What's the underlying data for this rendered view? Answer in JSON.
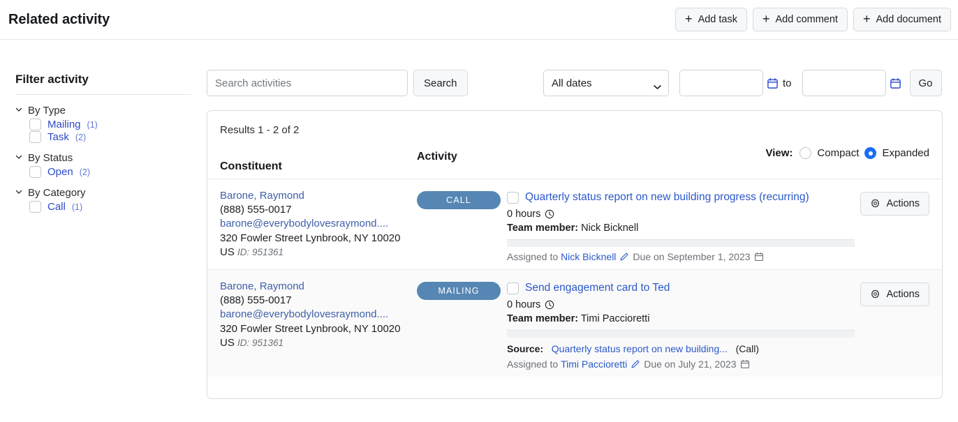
{
  "header": {
    "title": "Related activity",
    "buttons": [
      {
        "label": "Add task",
        "icon": "plus-icon"
      },
      {
        "label": "Add comment",
        "icon": "plus-icon"
      },
      {
        "label": "Add document",
        "icon": "plus-icon"
      }
    ]
  },
  "sidebar": {
    "title": "Filter activity",
    "groups": [
      {
        "label": "By Type",
        "expanded": true,
        "items": [
          {
            "label": "Mailing",
            "count": "(1)",
            "checked": false
          },
          {
            "label": "Task",
            "count": "(2)",
            "checked": false
          }
        ]
      },
      {
        "label": "By Status",
        "expanded": true,
        "items": [
          {
            "label": "Open",
            "count": "(2)",
            "checked": false
          }
        ]
      },
      {
        "label": "By Category",
        "expanded": true,
        "items": [
          {
            "label": "Call",
            "count": "(1)",
            "checked": false
          }
        ]
      }
    ]
  },
  "toolbar": {
    "search_placeholder": "Search activities",
    "search_value": "",
    "search_button": "Search",
    "date_filter_selected": "All dates",
    "date_from_value": "",
    "date_to_value": "",
    "to_label": "to",
    "go_button": "Go"
  },
  "results": {
    "count_text": "Results 1 - 2 of 2",
    "columns": {
      "constituent": "Constituent",
      "activity": "Activity"
    },
    "view": {
      "label": "View:",
      "options": [
        "Compact",
        "Expanded"
      ],
      "selected": "Expanded"
    },
    "actions_button": "Actions",
    "rows": [
      {
        "constituent": {
          "name": "Barone, Raymond",
          "phone": "(888) 555-0017",
          "email": "barone@everybodylovesraymond....",
          "address1": "320 Fowler Street",
          "address2": "Lynbrook, NY 10020",
          "country": "US",
          "id": "ID: 951361"
        },
        "badge": "CALL",
        "title": "Quarterly status report on new building progress (recurring)",
        "hours": "0 hours",
        "team_member_label": "Team member:",
        "team_member": "Nick Bicknell",
        "source_label": "",
        "source_link": "",
        "source_type": "",
        "assigned_prefix": "Assigned to",
        "assigned_to": "Nick Bicknell",
        "due_text": "Due on September 1, 2023",
        "checked": false
      },
      {
        "constituent": {
          "name": "Barone, Raymond",
          "phone": "(888) 555-0017",
          "email": "barone@everybodylovesraymond....",
          "address1": "320 Fowler Street",
          "address2": "Lynbrook, NY 10020",
          "country": "US",
          "id": "ID: 951361"
        },
        "badge": "MAILING",
        "title": "Send engagement card to Ted",
        "hours": "0 hours",
        "team_member_label": "Team member:",
        "team_member": "Timi Paccioretti",
        "source_label": "Source:",
        "source_link": "Quarterly status report on new building...",
        "source_type": "(Call)",
        "assigned_prefix": "Assigned to",
        "assigned_to": "Timi Paccioretti",
        "due_text": "Due on July 21, 2023",
        "checked": false
      }
    ]
  },
  "colors": {
    "badge": "#5686b4",
    "link": "#2b58c9",
    "filter_link": "#2b4acb",
    "radio_accent": "#1a6ef5",
    "calendar_icon": "#2b4acb"
  }
}
